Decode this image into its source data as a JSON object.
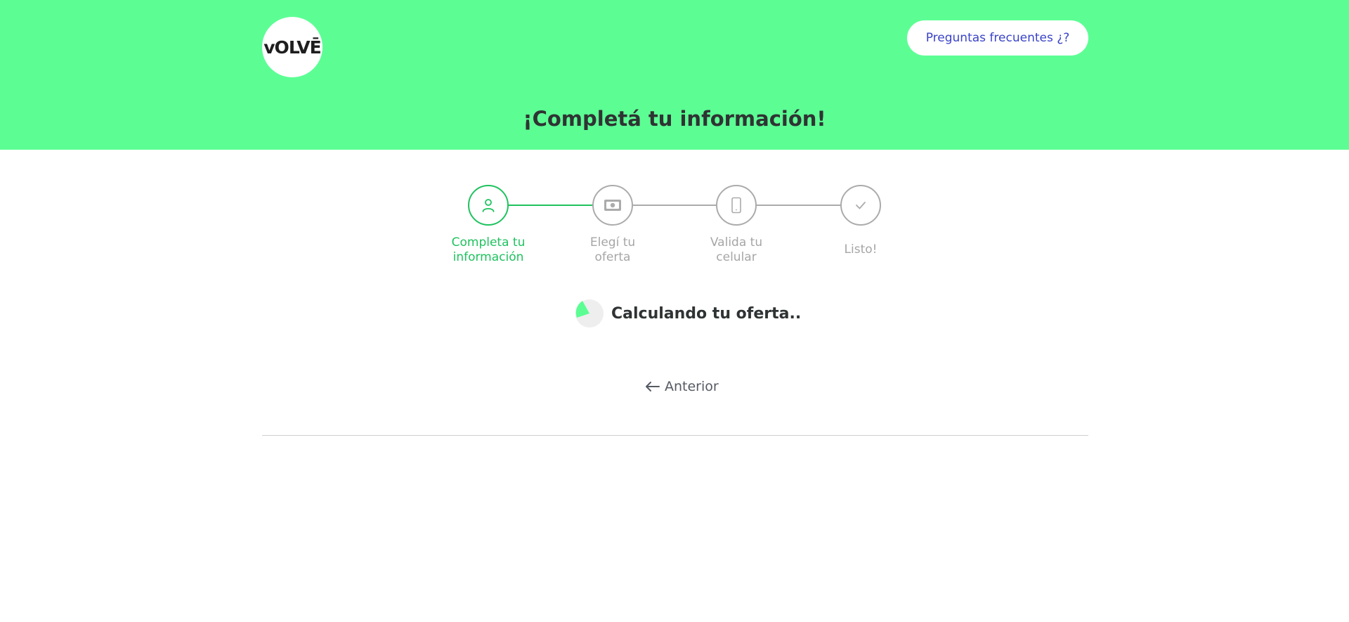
{
  "header": {
    "logo_text": "vOLVĒ",
    "faq_label": "Preguntas frecuentes ¿?",
    "title": "¡Completá tu información!"
  },
  "stepper": {
    "steps": [
      {
        "line1": "Completa tu",
        "line2": "información",
        "icon": "user-icon",
        "state": "active"
      },
      {
        "line1": "Elegí tu",
        "line2": "oferta",
        "icon": "money-icon",
        "state": "inactive"
      },
      {
        "line1": "Valida tu",
        "line2": "celular",
        "icon": "phone-icon",
        "state": "inactive"
      },
      {
        "line1": "Listo!",
        "line2": "",
        "icon": "check-icon",
        "state": "inactive"
      }
    ]
  },
  "loading": {
    "text": "Calculando tu oferta.."
  },
  "nav": {
    "previous_label": "Anterior"
  },
  "colors": {
    "header_bg": "#5cfe94",
    "active": "#1fc25e",
    "inactive": "#ababab",
    "link": "#3a43c8"
  }
}
